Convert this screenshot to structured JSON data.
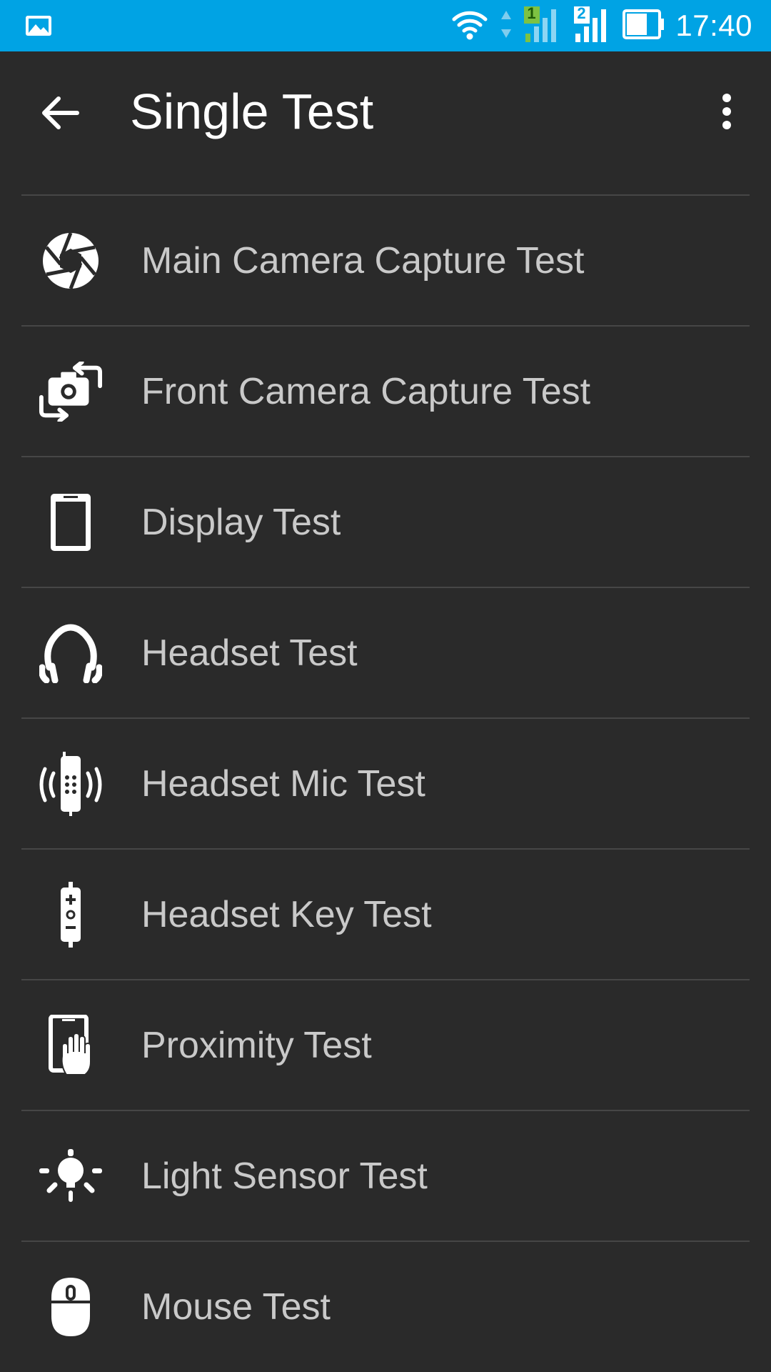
{
  "status_bar": {
    "time": "17:40",
    "icons": [
      "gallery-notification-icon",
      "wifi-icon",
      "data-arrows-icon",
      "sim1-signal-icon",
      "sim2-signal-icon",
      "battery-icon"
    ],
    "sim1_label": "1",
    "sim2_label": "2",
    "colors": {
      "background": "#00a3e4",
      "sim1_accent": "#7dc242"
    }
  },
  "app_bar": {
    "title": "Single Test",
    "back_icon": "arrow-left-icon",
    "menu_icon": "more-vert-icon"
  },
  "tests": [
    {
      "label": "Main Camera Capture Test",
      "icon": "camera-shutter-icon"
    },
    {
      "label": "Front Camera Capture Test",
      "icon": "camera-switch-icon"
    },
    {
      "label": "Display Test",
      "icon": "phone-display-icon"
    },
    {
      "label": "Headset Test",
      "icon": "headphones-icon"
    },
    {
      "label": "Headset Mic Test",
      "icon": "vibrating-mic-icon"
    },
    {
      "label": "Headset Key Test",
      "icon": "headset-remote-icon"
    },
    {
      "label": "Proximity Test",
      "icon": "proximity-hand-icon"
    },
    {
      "label": "Light Sensor Test",
      "icon": "light-bulb-icon"
    },
    {
      "label": "Mouse Test",
      "icon": "mouse-icon"
    }
  ],
  "colors": {
    "background": "#2a2a2a",
    "divider": "#464646",
    "label_text": "#c9c9c9",
    "title_text": "#ffffff"
  }
}
